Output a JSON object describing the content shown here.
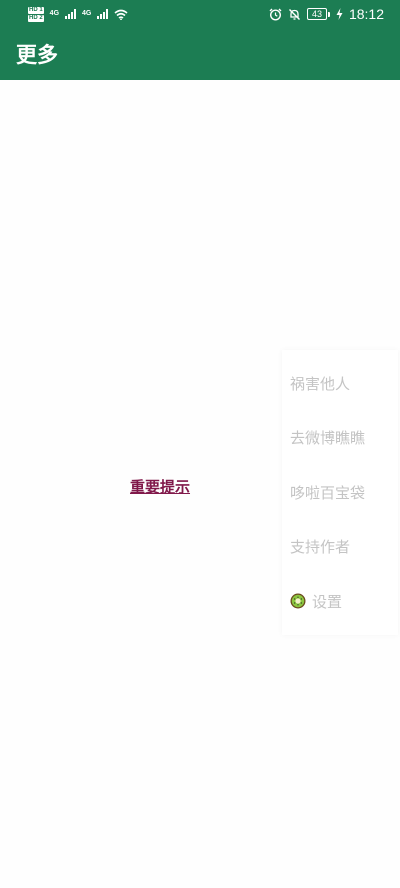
{
  "status_bar": {
    "hd_badges": [
      "HD 1",
      "HD 2"
    ],
    "network_label_1": "4G",
    "network_label_2": "4G",
    "battery_level": "43",
    "time": "18:12"
  },
  "toolbar": {
    "title": "更多"
  },
  "main": {
    "notice_link": "重要提示"
  },
  "menu": {
    "items": [
      {
        "label": "祸害他人"
      },
      {
        "label": "去微博瞧瞧"
      },
      {
        "label": "哆啦百宝袋"
      },
      {
        "label": "支持作者"
      },
      {
        "label": "设置",
        "icon": "kiwi-icon"
      }
    ]
  },
  "colors": {
    "primary": "#1c7d53",
    "link": "#80184a",
    "menu_text": "#c4c4c4"
  }
}
